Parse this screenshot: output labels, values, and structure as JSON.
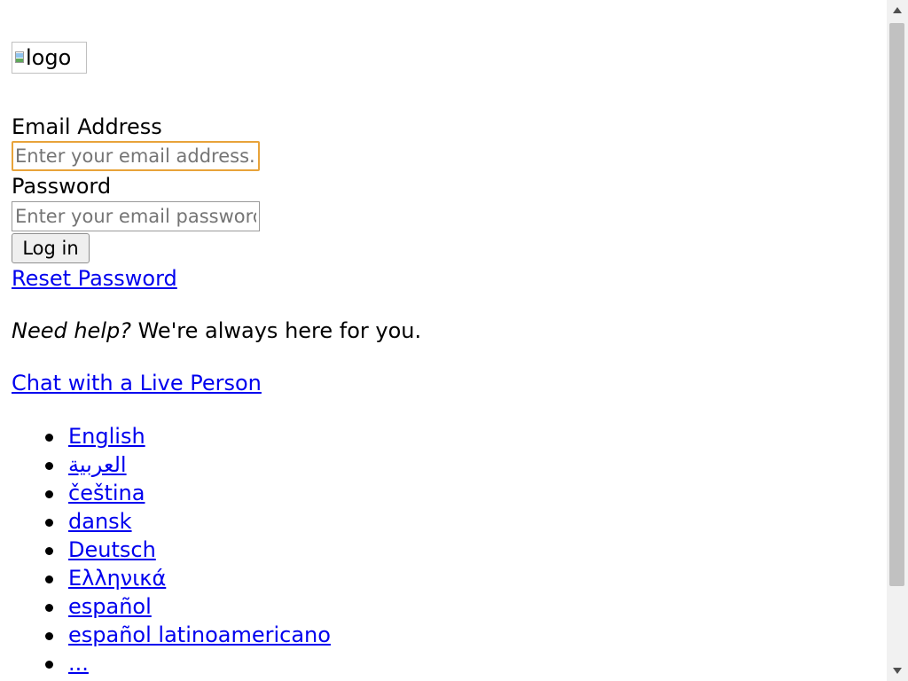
{
  "logo": {
    "alt_text": "logo"
  },
  "login_form": {
    "email_label": "Email Address",
    "email_placeholder": "Enter your email address.",
    "email_value": "",
    "password_label": "Password",
    "password_placeholder": "Enter your email password",
    "password_value": "",
    "submit_label": "Log in",
    "reset_link": "Reset Password"
  },
  "help": {
    "emphasis": "Need help?",
    "message": " We're always here for you.",
    "chat_link": "Chat with a Live Person"
  },
  "languages": [
    {
      "label": "English"
    },
    {
      "label": "العربية"
    },
    {
      "label": "čeština"
    },
    {
      "label": "dansk"
    },
    {
      "label": "Deutsch"
    },
    {
      "label": "Ελληνικά"
    },
    {
      "label": "español"
    },
    {
      "label": "español latinoamericano"
    },
    {
      "label": "..."
    }
  ],
  "colors": {
    "link": "#0000ee",
    "focus_ring": "#e8a33a"
  }
}
